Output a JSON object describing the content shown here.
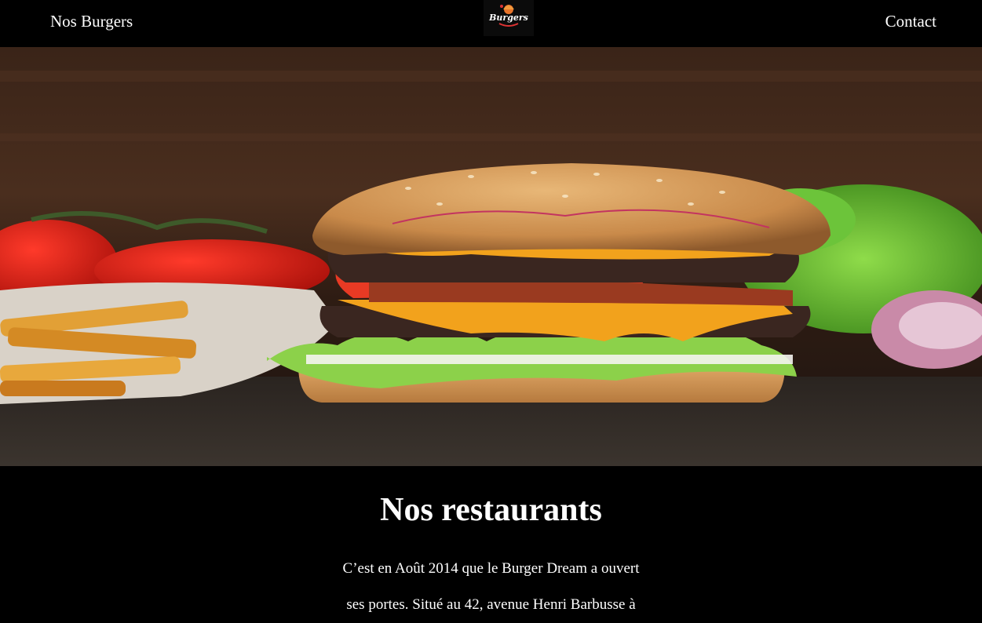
{
  "header": {
    "nav_left": "Nos Burgers",
    "nav_right": "Contact",
    "logo_text": "Burgers"
  },
  "hero": {
    "image": "burger-photo"
  },
  "section": {
    "title": "Nos restaurants",
    "paragraph_lines": [
      "C’est en Août 2014 que le Burger Dream a ouvert",
      "ses portes. Situé au 42, avenue Henri Barbusse à"
    ]
  },
  "colors": {
    "background": "#000000",
    "text": "#ffffff",
    "accent": "#e8742a"
  }
}
